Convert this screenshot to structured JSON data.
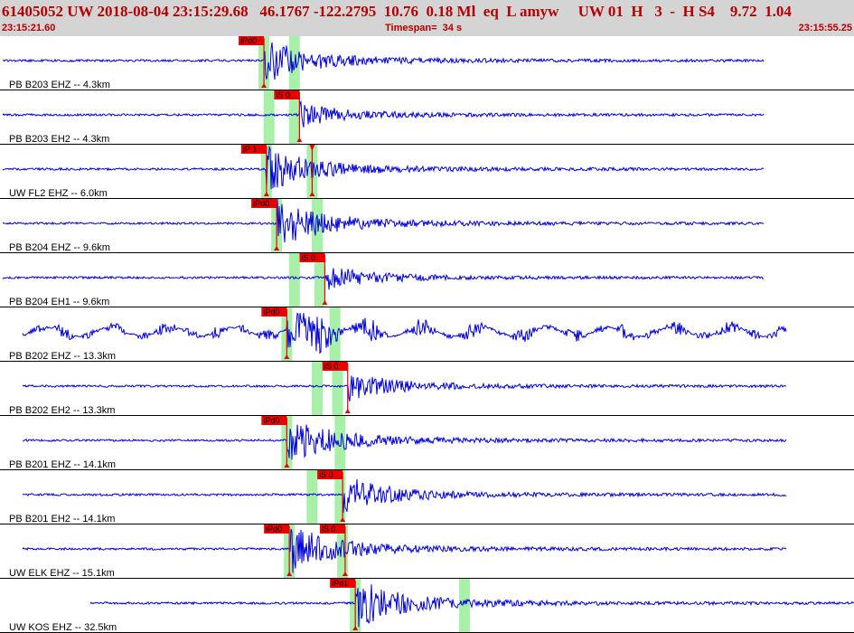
{
  "header": {
    "title_line": "61405052 UW 2018-08-04 23:15:29.68   46.1767 -122.2795  10.76  0.18 Ml  eq  L amyw     UW 01  H   3  -  H S4    9.72  1.04",
    "start_time": "23:15:21.60",
    "timespan_label": "Timespan=  34 s",
    "end_time": "23:15:55.25"
  },
  "colors": {
    "header_bg": "#d4d4d4",
    "header_text": "#b40000",
    "trace": "#0000d8",
    "pick_window": "#a8f0a8",
    "pick_flag": "#e80000",
    "pick_line": "#e80000",
    "grid": "#000000"
  },
  "chart_data": {
    "type": "line",
    "title": "",
    "x_unit": "s",
    "x_range": [
      0,
      33.65
    ],
    "traces": [
      {
        "label": "PB B203 EHZ -- 4.3km",
        "picks": [
          {
            "label": "iPd0",
            "t": 10.4
          }
        ],
        "s_window": 11.6,
        "amp": 0.9
      },
      {
        "label": "PB B203 EH2 -- 4.3km",
        "picks": [
          {
            "label": "iS 0",
            "t": 11.8
          }
        ],
        "s_window": 11.6,
        "amp": 0.5
      },
      {
        "label": "UW FL2 EHZ -- 6.0km",
        "picks": [
          {
            "label": "iP 1",
            "t": 10.5
          },
          {
            "label": "",
            "t": 12.3
          }
        ],
        "s_window": 12.3,
        "amp": 0.9
      },
      {
        "label": "PB B204 EHZ -- 9.6km",
        "picks": [
          {
            "label": "iPd0",
            "t": 10.9
          }
        ],
        "s_window": 12.5,
        "amp": 1.0
      },
      {
        "label": "PB B204 EH1 -- 9.6km",
        "picks": [
          {
            "label": "iS 0",
            "t": 12.8
          }
        ],
        "s_window": 12.6,
        "amp": 0.5
      },
      {
        "label": "PB B202 EHZ -- 13.3km",
        "picks": [
          {
            "label": "iPd0",
            "t": 11.3
          }
        ],
        "s_window": 13.2,
        "amp": 1.0
      },
      {
        "label": "PB B202 EH2 -- 13.3km",
        "picks": [
          {
            "label": "iS 0",
            "t": 13.7
          }
        ],
        "s_window": 13.3,
        "amp": 0.6
      },
      {
        "label": "PB B201 EHZ -- 14.1km",
        "picks": [
          {
            "label": "iPd0",
            "t": 11.3
          }
        ],
        "s_window": 13.4,
        "amp": 1.0
      },
      {
        "label": "PB B201 EH2 -- 14.1km",
        "picks": [
          {
            "label": "iS 0",
            "t": 13.5
          }
        ],
        "s_window": 13.4,
        "amp": 0.8
      },
      {
        "label": "UW ELK EHZ -- 15.1km",
        "picks": [
          {
            "label": "iPd0",
            "t": 11.4
          },
          {
            "label": "iS 0",
            "t": 13.6
          }
        ],
        "s_window": 13.5,
        "amp": 1.0
      },
      {
        "label": "UW KOS EHZ -- 32.5km",
        "picks": [
          {
            "label": "iPd1",
            "t": 14.0
          }
        ],
        "s_window": 18.3,
        "amp": 1.0
      }
    ]
  }
}
